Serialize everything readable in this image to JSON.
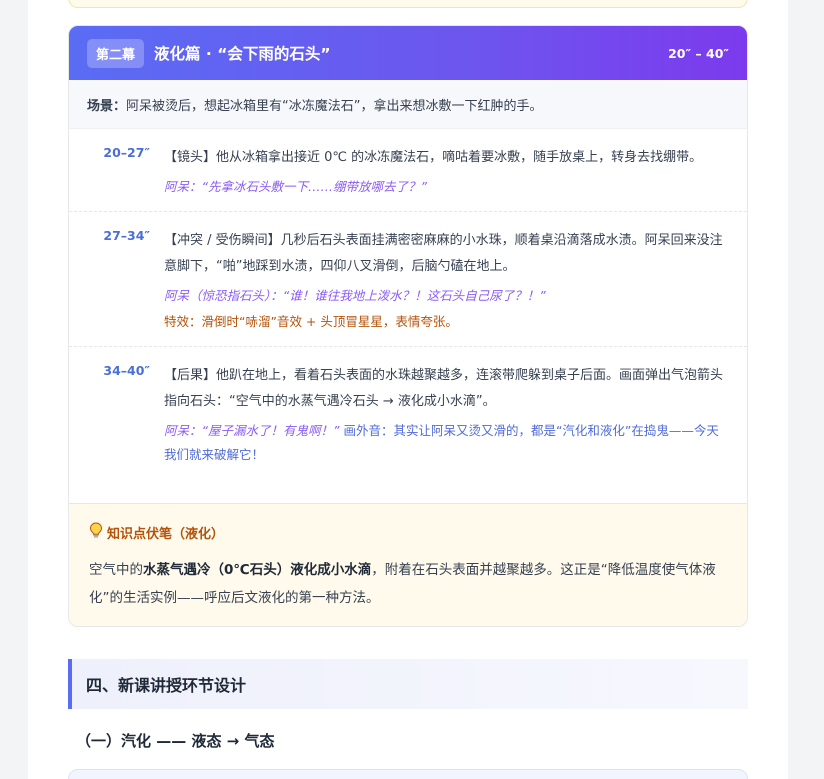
{
  "chapter": {
    "badge": "第二幕",
    "title": "液化篇 · “会下雨的石头”",
    "time": "20″ – 40″",
    "scene_label": "场景：",
    "scene_text": "阿呆被烫后，想起冰箱里有“冰冻魔法石”，拿出来想冰敷一下红肿的手。",
    "shots": [
      {
        "time": "20–27″",
        "desc": "【镜头】他从冰箱拿出接近 0℃ 的冰冻魔法石，嘀咕着要冰敷，随手放桌上，转身去找绷带。",
        "dialog": "阿呆：“先拿冰石头敷一下……绷带放哪去了？”"
      },
      {
        "time": "27–34″",
        "desc": "【冲突 / 受伤瞬间】几秒后石头表面挂满密密麻麻的小水珠，顺着桌沿滴落成水渍。阿呆回来没注意脚下，“啪”地踩到水渍，四仰八叉滑倒，后脑勺磕在地上。",
        "dialog": "阿呆（惊恐指石头）：“谁！谁往我地上泼水？！这石头自己尿了？！”",
        "effect": "特效：滑倒时“哧溜”音效 + 头顶冒星星，表情夸张。"
      },
      {
        "time": "34–40″",
        "desc": "【后果】他趴在地上，看着石头表面的水珠越聚越多，连滚带爬躲到桌子后面。画面弹出气泡箭头指向石头：“空气中的水蒸气遇冷石头 → 液化成小水滴”。",
        "dialog": "阿呆：“屋子漏水了！有鬼啊！”",
        "voiceover": "画外音：其实让阿呆又烫又滑的，都是“汽化和液化”在捣鬼——今天我们就来破解它！"
      }
    ],
    "knowledge": {
      "title": "知识点伏笔（液化）",
      "text_pre": "空气中的",
      "text_bold": "水蒸气遇冷（0℃石头）液化成小水滴",
      "text_post": "，附着在石头表面并越聚越多。这正是“降低温度使气体液化”的生活实例——呼应后文液化的第一种方法。"
    }
  },
  "section": {
    "title": "四、新课讲授环节设计",
    "subtitle": "（一）汽化 —— 液态 → 气态"
  },
  "colors": {
    "accent": "#5a6cf4",
    "shot_time": "#4a6fd8",
    "dialog": "#8b5cf6",
    "effect": "#b45309",
    "knowledge_bg": "#fffaeb"
  },
  "icons": {
    "knowledge": "lightbulb-icon"
  }
}
